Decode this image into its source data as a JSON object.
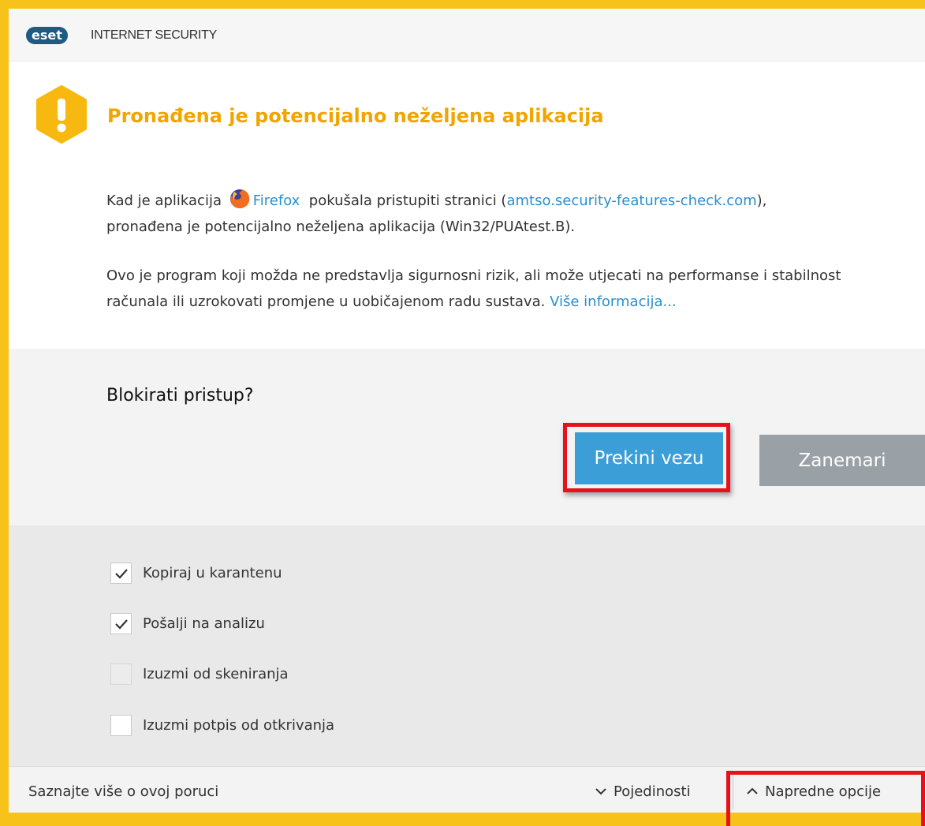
{
  "app": {
    "logo_text": "eset",
    "title": "INTERNET SECURITY"
  },
  "alert": {
    "title": "Pronađena je potencijalno neželjena aplikacija",
    "icon": "warning-icon",
    "message1": {
      "prefix": "Kad je aplikacija",
      "app_icon": "firefox-icon",
      "app_name": "Firefox",
      "middle": "pokušala pristupiti stranici (",
      "site": "amtso.security-features-check.com",
      "suffix": "),",
      "line2": "pronađena je potencijalno neželjena aplikacija (Win32/PUAtest.B)."
    },
    "message2": {
      "text": "Ovo je program koji možda ne predstavlja sigurnosni rizik, ali može utjecati na performanse i stabilnost računala ili uzrokovati promjene u uobičajenom radu sustava.",
      "link": "Više informacija..."
    }
  },
  "question": {
    "text": "Blokirati pristup?",
    "primary_button": "Prekini vezu",
    "secondary_button": "Zanemari"
  },
  "options": [
    {
      "label": "Kopiraj u karantenu",
      "checked": true
    },
    {
      "label": "Pošalji na analizu",
      "checked": true
    },
    {
      "label": "Izuzmi od skeniranja",
      "checked": false
    },
    {
      "label": "Izuzmi potpis od otkrivanja",
      "checked": false
    }
  ],
  "footer": {
    "learn_more": "Saznajte više o ovoj poruci",
    "details": "Pojedinosti",
    "advanced": "Napredne opcije"
  },
  "colors": {
    "frame": "#f7c31a",
    "title_accent": "#f0a500",
    "link": "#2a8fcf",
    "primary_button": "#3b9ed6",
    "secondary_button": "#9aa1a6",
    "highlight": "#e8101a"
  }
}
